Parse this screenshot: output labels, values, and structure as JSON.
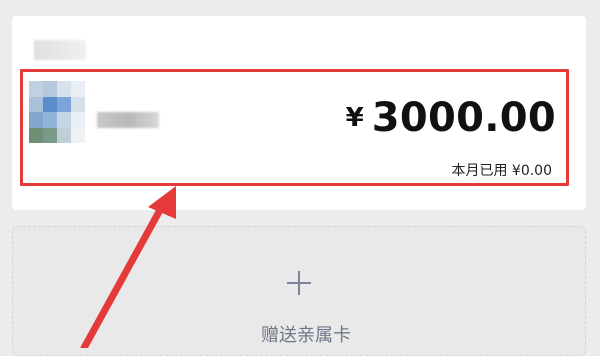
{
  "family_card": {
    "currency_symbol": "¥",
    "amount": "3000.00",
    "used_this_month": "本月已用 ¥0.00"
  },
  "action": {
    "label": "赠送亲属卡"
  },
  "colors": {
    "highlight": "#e53a3a",
    "background": "#ececec",
    "card": "#ffffff",
    "action_text": "#6f7787"
  },
  "icons": {
    "plus": "plus-icon",
    "arrow": "red-arrow-icon"
  }
}
